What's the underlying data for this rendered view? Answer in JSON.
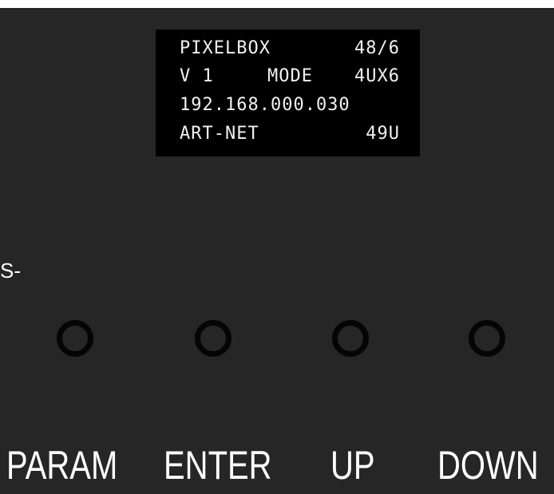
{
  "display": {
    "line1": {
      "left": "PIXELBOX",
      "right": "48/6"
    },
    "line2": {
      "left": "V 1",
      "middle": "MODE",
      "right": "4UX6"
    },
    "line3": {
      "left": "192.168.000.030"
    },
    "line4": {
      "left": "ART-NET",
      "right": "49U"
    }
  },
  "side_label": "S-",
  "buttons": {
    "param": "PARAM",
    "enter": "ENTER",
    "up": "UP",
    "down": "DOWN"
  },
  "colors": {
    "panel": "#262626",
    "screen": "#000000",
    "text": "#ffffff",
    "button_ring": "#050505"
  }
}
